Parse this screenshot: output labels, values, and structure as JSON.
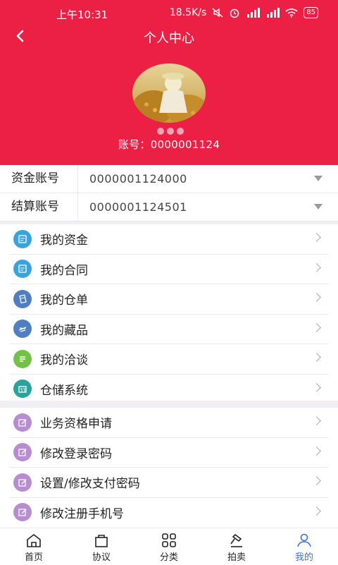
{
  "status": {
    "time": "上午10:31",
    "speed": "18.5K/s",
    "battery": "85"
  },
  "header": {
    "title": "个人中心",
    "account_label": "账号：",
    "account_number": "0000001124"
  },
  "accounts": [
    {
      "label": "资金账号",
      "value": "0000001124000"
    },
    {
      "label": "结算账号",
      "value": "0000001124501"
    }
  ],
  "menu_group1": [
    {
      "label": "我的资金",
      "icon": "wallet-icon",
      "color": "#3aa4da"
    },
    {
      "label": "我的合同",
      "icon": "contract-icon",
      "color": "#3aa4da"
    },
    {
      "label": "我的仓单",
      "icon": "receipt-icon",
      "color": "#4f7fc0"
    },
    {
      "label": "我的藏品",
      "icon": "collection-icon",
      "color": "#4f7fc0"
    },
    {
      "label": "我的洽谈",
      "icon": "chat-icon",
      "color": "#74c04a"
    },
    {
      "label": "仓储系统",
      "icon": "warehouse-icon",
      "color": "#2aa39a"
    }
  ],
  "menu_group2": [
    {
      "label": "业务资格申请",
      "icon": "edit-icon",
      "color": "#b88dcf"
    },
    {
      "label": "修改登录密码",
      "icon": "edit-icon",
      "color": "#b88dcf"
    },
    {
      "label": "设置/修改支付密码",
      "icon": "edit-icon",
      "color": "#b88dcf"
    },
    {
      "label": "修改注册手机号",
      "icon": "edit-icon",
      "color": "#b88dcf"
    }
  ],
  "tabs": [
    {
      "label": "首页",
      "icon": "home-icon"
    },
    {
      "label": "协议",
      "icon": "bag-icon"
    },
    {
      "label": "分类",
      "icon": "grid-icon"
    },
    {
      "label": "拍卖",
      "icon": "gavel-icon"
    },
    {
      "label": "我的",
      "icon": "user-icon",
      "active": true
    }
  ],
  "colors": {
    "header_bg": "#ec1f45",
    "active_tab": "#3b6fd6"
  }
}
